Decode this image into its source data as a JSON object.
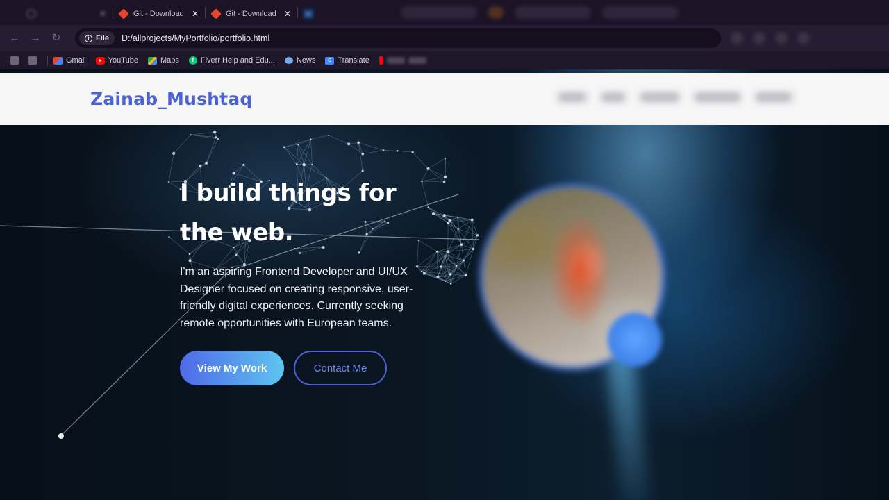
{
  "browser": {
    "tabs": [
      {
        "title": "",
        "icon": "globe-icon",
        "blurred": true,
        "close": "✕"
      },
      {
        "title": "Git - Download",
        "icon": "git-icon",
        "blurred": false,
        "close": "✕"
      },
      {
        "title": "Git - Download",
        "icon": "git-icon",
        "blurred": false,
        "close": "✕"
      },
      {
        "title": "",
        "icon": "linkedin-icon",
        "icon_text": "in",
        "blurred": true,
        "close": ""
      }
    ],
    "address": {
      "scheme_label": "File",
      "url": "D:/allprojects/MyPortfolio/portfolio.html"
    },
    "bookmarks": [
      {
        "label": "Gmail",
        "icon": "gmail-icon"
      },
      {
        "label": "YouTube",
        "icon": "youtube-icon"
      },
      {
        "label": "Maps",
        "icon": "maps-icon"
      },
      {
        "label": "Fiverr Help and Edu...",
        "icon": "fiverr-icon"
      },
      {
        "label": "News",
        "icon": "news-icon"
      },
      {
        "label": "Translate",
        "icon": "translate-icon"
      },
      {
        "label": "",
        "icon": "netflix-icon"
      }
    ],
    "colors": {
      "tabbar": "#1c1426",
      "toolbar": "#271d33",
      "omnibox": "#150f1d"
    }
  },
  "site": {
    "brand": "Zainab_Mushtaq",
    "brand_color": "#4b62d4",
    "hero": {
      "title": "I build things for the web.",
      "description": "I'm an aspiring Frontend Developer and UI/UX Designer focused on creating responsive, user-friendly digital experiences. Currently seeking remote opportunities with European teams.",
      "primary_cta": "View My Work",
      "secondary_cta": "Contact Me"
    },
    "colors": {
      "accent_start": "#4f6ae8",
      "accent_end": "#5ec4ef",
      "outline": "#4e5fd8"
    }
  }
}
